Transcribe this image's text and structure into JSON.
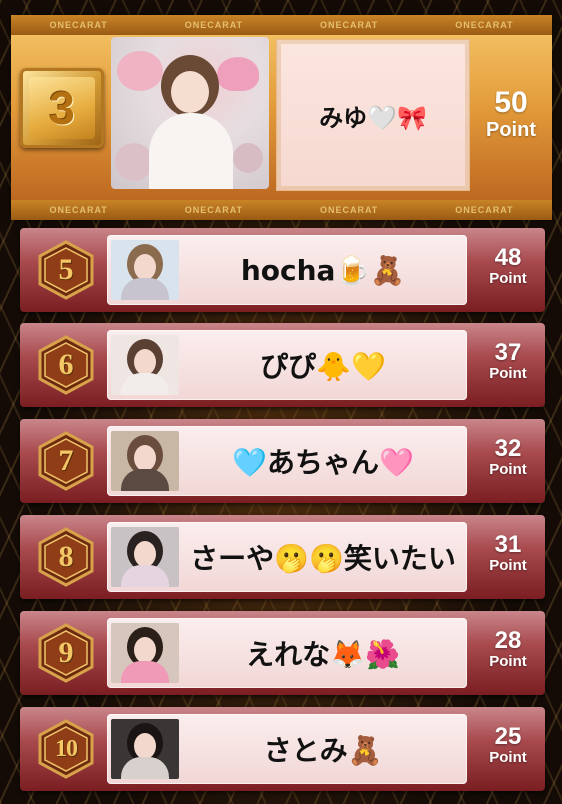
{
  "brand": "ONECARAT",
  "featured": {
    "rank": "3",
    "name": "みゆ🤍🎀",
    "points": "50",
    "points_label": "Point"
  },
  "entries": [
    {
      "rank": "5",
      "name": "hocha🍺🧸",
      "points": "48",
      "points_label": "Point"
    },
    {
      "rank": "6",
      "name": "ぴぴ🐥💛",
      "points": "37",
      "points_label": "Point"
    },
    {
      "rank": "7",
      "name": "🩵あちゃん🩷",
      "points": "32",
      "points_label": "Point"
    },
    {
      "rank": "8",
      "name": "さーや🫢🫢笑いたい",
      "points": "31",
      "points_label": "Point"
    },
    {
      "rank": "9",
      "name": "えれな🦊🌺",
      "points": "28",
      "points_label": "Point"
    },
    {
      "rank": "10",
      "name": "さとみ🧸",
      "points": "25",
      "points_label": "Point"
    }
  ]
}
